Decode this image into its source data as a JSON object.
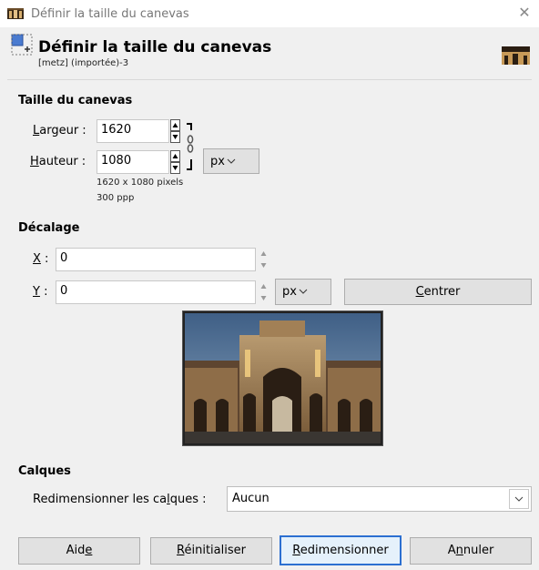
{
  "window": {
    "title": "Définir la taille du canevas",
    "close_glyph": "✕"
  },
  "header": {
    "title": "Définir la taille du canevas",
    "subtitle": "[metz] (importée)-3"
  },
  "canvas_size": {
    "section_title": "Taille du canevas",
    "width_label": "Largeur :",
    "width_value": "1620",
    "height_label": "Hauteur :",
    "height_value": "1080",
    "unit": "px",
    "pixels_info": "1620 x 1080 pixels",
    "resolution_info": "300 ppp"
  },
  "offset": {
    "section_title": "Décalage",
    "x_label": "X :",
    "x_value": "0",
    "y_label": "Y :",
    "y_value": "0",
    "unit": "px",
    "center_label": "Centrer"
  },
  "layers": {
    "section_title": "Calques",
    "resize_label": "Redimensionner les calques :",
    "resize_value": "Aucun"
  },
  "buttons": {
    "help": "Aide",
    "reset": "Réinitialiser",
    "resize": "Redimensionner",
    "cancel": "Annuler"
  },
  "icons": {
    "app": "gimp-canvas-icon",
    "chain": "chain-link-icon",
    "dropdown": "chevron-down-icon"
  }
}
